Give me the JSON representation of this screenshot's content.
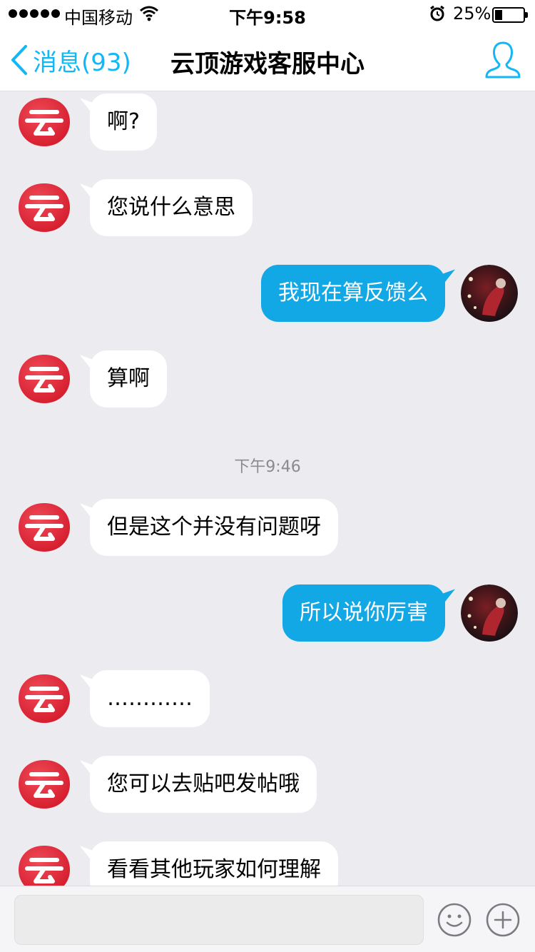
{
  "status_bar": {
    "carrier": "中国移动",
    "time": "下午9:58",
    "battery_percent": "25%",
    "battery_level": 0.25,
    "signal_dots": 5
  },
  "nav": {
    "back_label": "消息(93)",
    "title": "云顶游戏客服中心"
  },
  "chat": {
    "messages": [
      {
        "from": "service",
        "text": "啊?"
      },
      {
        "from": "service",
        "text": "您说什么意思"
      },
      {
        "from": "me",
        "text": "我现在算反馈么"
      },
      {
        "from": "service",
        "text": "算啊"
      },
      {
        "from": "service",
        "text": "但是这个并没有问题呀"
      },
      {
        "from": "me",
        "text": "所以说你厉害"
      },
      {
        "from": "service",
        "text": "…………"
      },
      {
        "from": "service",
        "text": "您可以去贴吧发帖哦"
      },
      {
        "from": "service",
        "text": "看看其他玩家如何理解"
      }
    ],
    "time_divider": "下午9:46"
  },
  "input_bar": {
    "placeholder": ""
  },
  "colors": {
    "accent": "#12b7f5",
    "outgoing_bubble": "#12a7e5",
    "chat_background": "#ebebf0",
    "service_avatar_red": "#d41c2c"
  },
  "icons": {
    "back": "chevron-left-icon",
    "profile": "person-outline-icon",
    "emoji": "smiley-face-icon",
    "more": "plus-circle-icon",
    "service_avatar": "yun-logo-icon",
    "user_avatar": "user-photo"
  }
}
